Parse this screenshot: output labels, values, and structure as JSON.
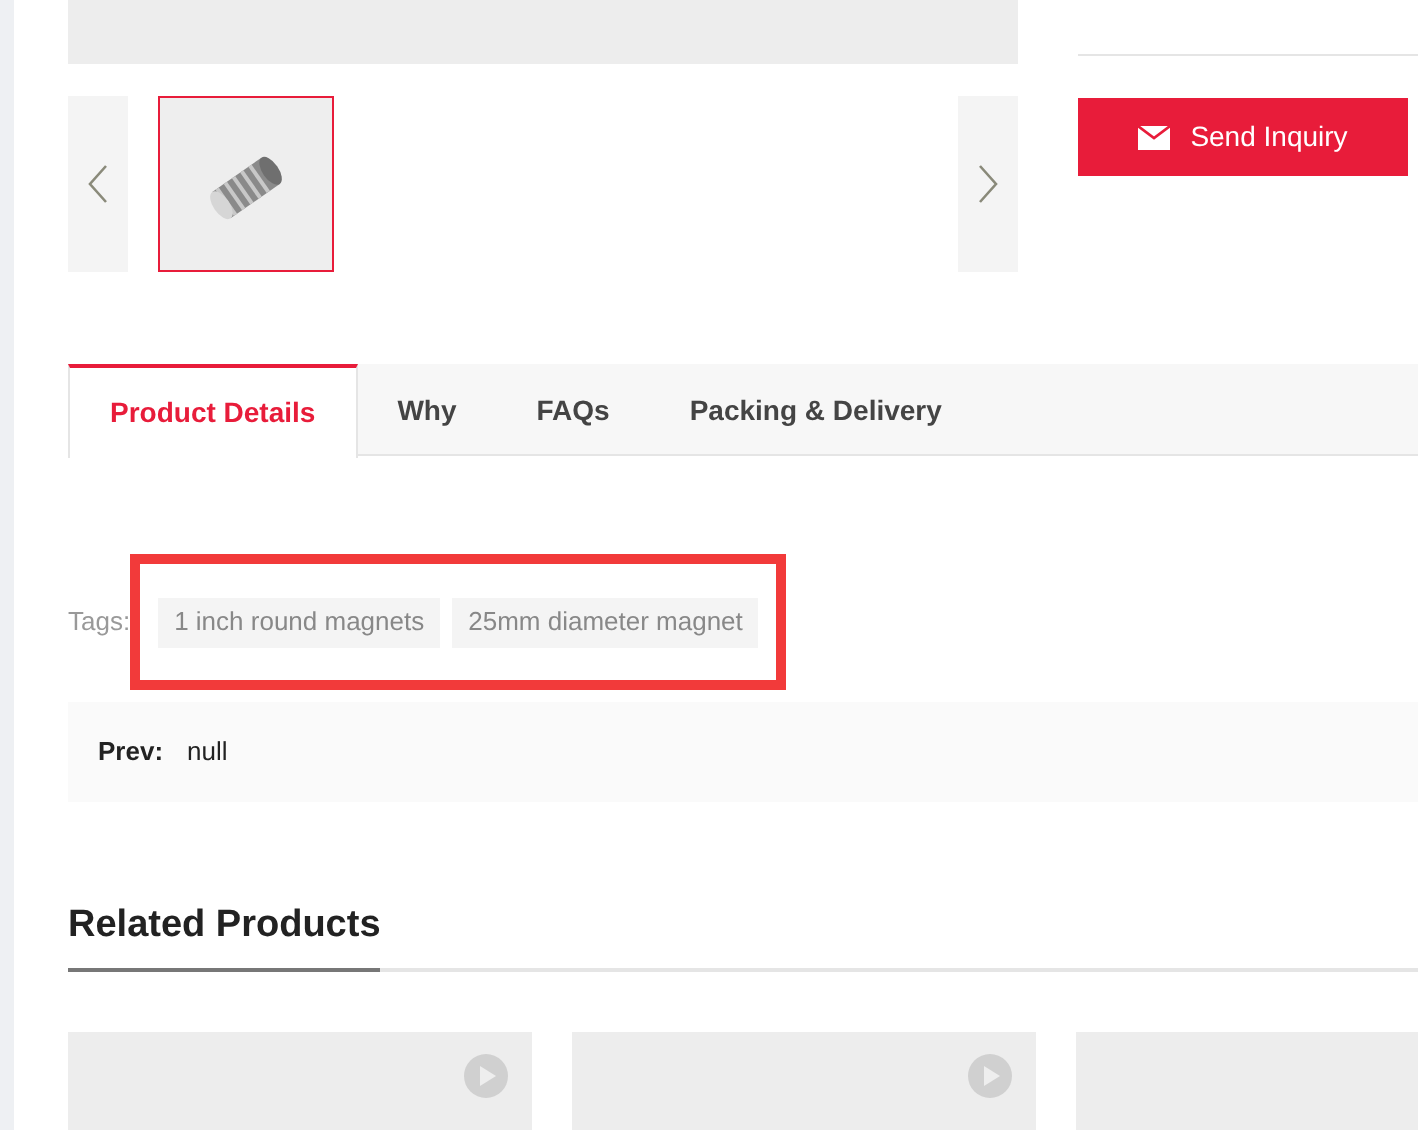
{
  "gallery": {
    "thumbnails": [
      {
        "kind": "picture",
        "selected": true
      }
    ]
  },
  "inquiry_button": {
    "label": "Send Inquiry"
  },
  "tabs": [
    {
      "label": "Product Details",
      "selected": true
    },
    {
      "label": "Why",
      "selected": false
    },
    {
      "label": "FAQs",
      "selected": false
    },
    {
      "label": "Packing & Delivery",
      "selected": false
    }
  ],
  "tags": {
    "label": "Tags:",
    "items": [
      "1 inch round magnets",
      "25mm diameter magnet"
    ]
  },
  "prev": {
    "label": "Prev:",
    "value": "null"
  },
  "related": {
    "title": "Related Products",
    "cards": [
      {
        "kind": "video"
      },
      {
        "kind": "video"
      },
      {
        "kind": "plain"
      }
    ]
  }
}
